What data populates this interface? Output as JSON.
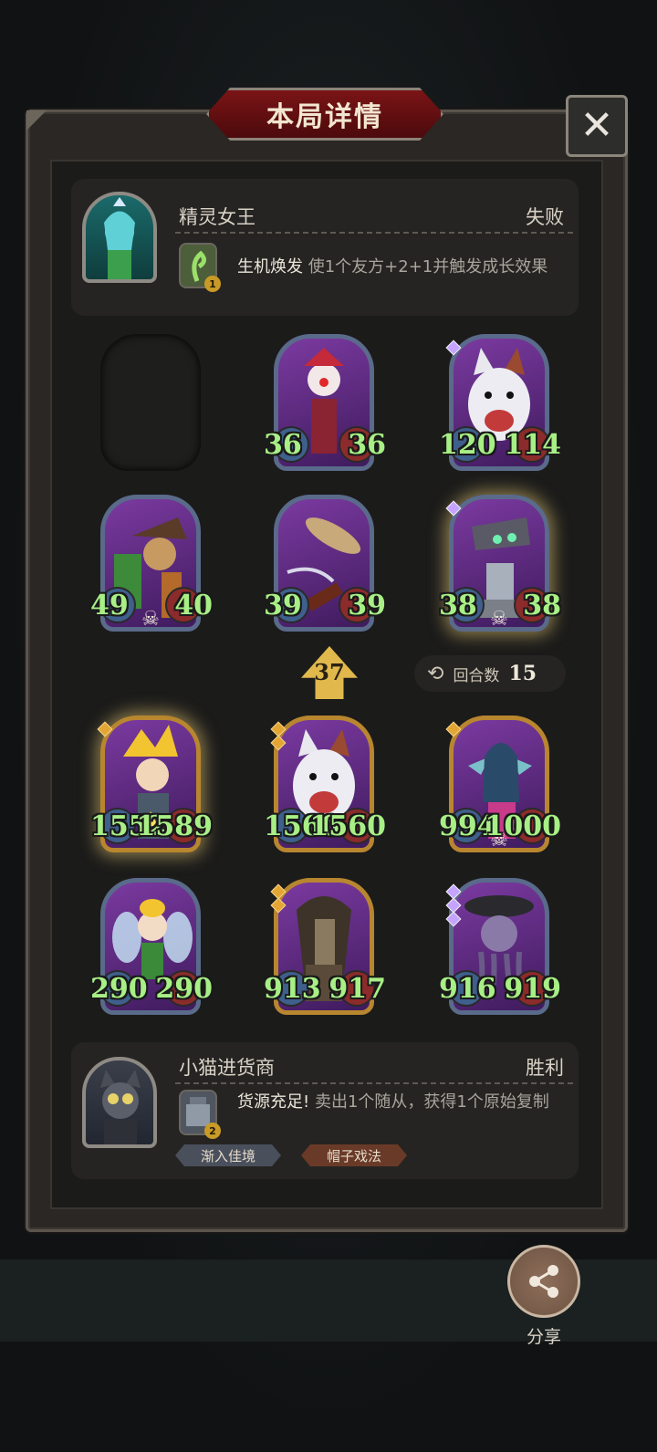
{
  "title": "本局详情",
  "close_icon": "close-icon",
  "opponent": {
    "name": "精灵女王",
    "result": "失败",
    "skill_name": "生机焕发",
    "skill_desc": "使1个友方+2+1并触发成长效果",
    "skill_level": "1"
  },
  "player": {
    "name": "小猫进货商",
    "result": "胜利",
    "skill_name": "货源充足!",
    "skill_desc": "卖出1个随从，获得1个原始复制",
    "skill_level": "2",
    "tags": [
      "渐入佳境",
      "帽子戏法"
    ]
  },
  "opponent_board": [
    {
      "empty": true
    },
    {
      "atk": "36",
      "hp": "36",
      "art": "clown",
      "border": "blue",
      "pips": 0
    },
    {
      "atk": "120",
      "hp": "114",
      "art": "wolf",
      "border": "blue",
      "pips": 1
    },
    {
      "atk": "49",
      "hp": "40",
      "art": "scarecrow-witch",
      "border": "blue",
      "skull": true,
      "pips": 0
    },
    {
      "atk": "39",
      "hp": "39",
      "art": "rocket",
      "border": "blue",
      "pips": 0
    },
    {
      "atk": "38",
      "hp": "38",
      "art": "robot",
      "border": "blue",
      "glow": true,
      "skull": true,
      "pips": 1
    }
  ],
  "player_board": [
    {
      "atk": "1552",
      "hp": "1589",
      "art": "blonde-hero",
      "border": "gold",
      "glow": true,
      "pips": 1
    },
    {
      "atk": "1560",
      "hp": "1560",
      "art": "wolf",
      "border": "gold",
      "pips": 2
    },
    {
      "atk": "994",
      "hp": "1000",
      "art": "elf-queen",
      "border": "gold",
      "skull": true,
      "pips": 1
    },
    {
      "atk": "290",
      "hp": "290",
      "art": "fairy",
      "border": "blue",
      "pips": 0
    },
    {
      "atk": "913",
      "hp": "917",
      "art": "hooded",
      "border": "gold",
      "pips": 2
    },
    {
      "atk": "916",
      "hp": "919",
      "art": "tentacle",
      "border": "blue",
      "pips": 3
    }
  ],
  "tavern_tier": "37",
  "rounds": {
    "label": "回合数",
    "value": "15"
  },
  "share_label": "分享",
  "colors": {
    "stat_green": "#a8ef86",
    "banner_red": "#7a1416",
    "gold_border": "#b8862f"
  }
}
